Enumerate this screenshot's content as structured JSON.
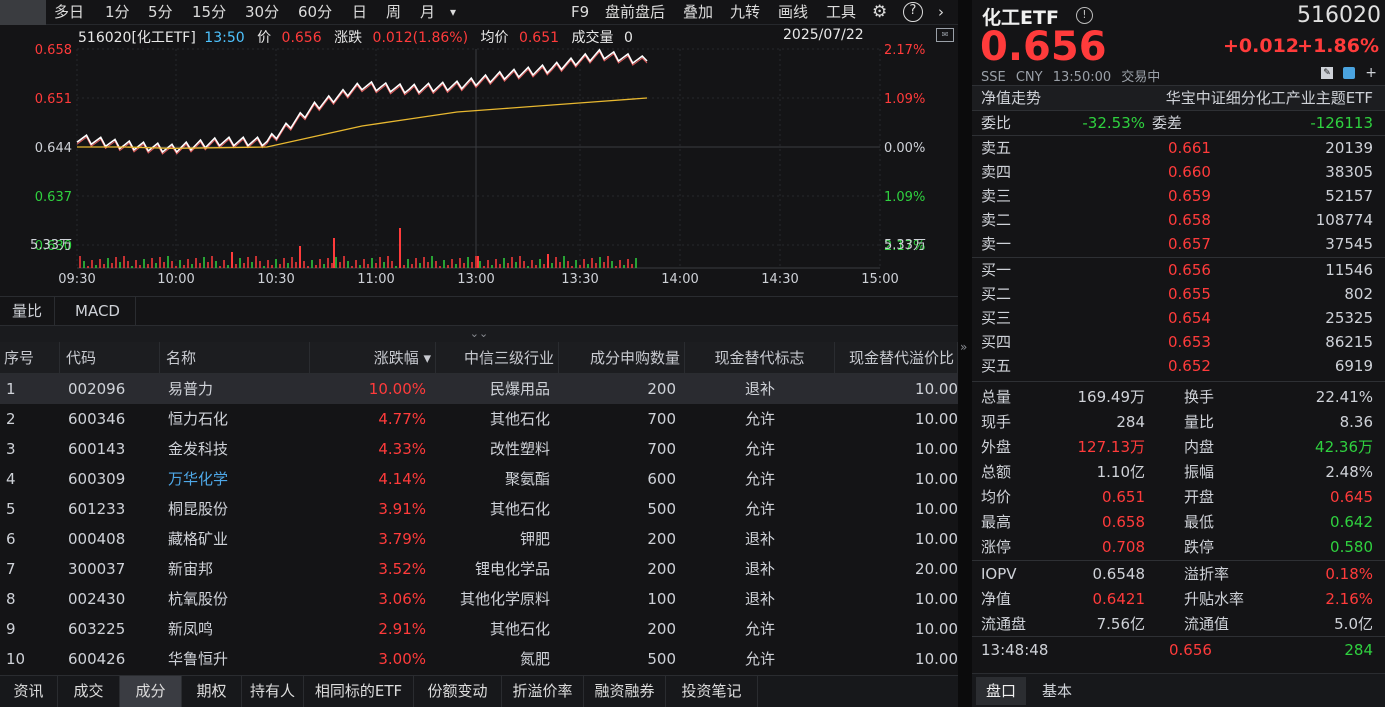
{
  "toolbar": {
    "items": [
      "多日",
      "1分",
      "5分",
      "15分",
      "30分",
      "60分",
      "日",
      "周",
      "月"
    ],
    "dropdown": "▾",
    "right_items": [
      "F9",
      "盘前盘后",
      "叠加",
      "九转",
      "画线",
      "工具"
    ]
  },
  "chart": {
    "header": {
      "code": "516020[化工ETF]",
      "time": "13:50",
      "price_label": "价",
      "price": "0.656",
      "change_label": "涨跌",
      "change": "0.012(1.86%)",
      "avg_label": "均价",
      "avg": "0.651",
      "vol_label": "成交量",
      "vol": "0",
      "date": "2025/07/22"
    },
    "y_left": [
      "0.658",
      "0.651",
      "0.644",
      "0.637",
      "0.630"
    ],
    "y_right": [
      "2.17%",
      "1.09%",
      "0.00%",
      "1.09%",
      "2.17%"
    ],
    "vol_max": "5.33万",
    "x_labels": [
      "09:30",
      "10:00",
      "10:30",
      "11:00",
      "13:00",
      "13:30",
      "14:00",
      "14:30",
      "15:00"
    ]
  },
  "chart_data": {
    "type": "line",
    "title": "516020[化工ETF]",
    "x": [
      "09:30",
      "09:45",
      "10:00",
      "10:15",
      "10:30",
      "10:45",
      "11:00",
      "11:15",
      "11:30/13:00",
      "13:15",
      "13:30",
      "13:45",
      "13:50"
    ],
    "series": [
      {
        "name": "价",
        "values": [
          0.645,
          0.644,
          0.6435,
          0.6445,
          0.6445,
          0.6495,
          0.6525,
          0.652,
          0.6525,
          0.654,
          0.655,
          0.657,
          0.656
        ]
      },
      {
        "name": "均价",
        "values": [
          0.644,
          0.644,
          0.6438,
          0.6439,
          0.644,
          0.6455,
          0.647,
          0.648,
          0.649,
          0.6495,
          0.65,
          0.6505,
          0.651
        ]
      }
    ],
    "ylim": [
      0.63,
      0.658
    ],
    "vol_max": "5.33万"
  },
  "indicator_tabs": [
    "量比",
    "MACD"
  ],
  "table": {
    "headers": [
      "序号",
      "代码",
      "名称",
      "涨跌幅 ▾",
      "中信三级行业",
      "成分申购数量",
      "现金替代标志",
      "现金替代溢价比"
    ],
    "rows": [
      [
        "1",
        "002096",
        "易普力",
        "10.00%",
        "民爆用品",
        "200",
        "退补",
        "10.00"
      ],
      [
        "2",
        "600346",
        "恒力石化",
        "4.77%",
        "其他石化",
        "700",
        "允许",
        "10.00"
      ],
      [
        "3",
        "600143",
        "金发科技",
        "4.33%",
        "改性塑料",
        "700",
        "允许",
        "10.00"
      ],
      [
        "4",
        "600309",
        "万华化学",
        "4.14%",
        "聚氨酯",
        "600",
        "允许",
        "10.00"
      ],
      [
        "5",
        "601233",
        "桐昆股份",
        "3.91%",
        "其他石化",
        "500",
        "允许",
        "10.00"
      ],
      [
        "6",
        "000408",
        "藏格矿业",
        "3.79%",
        "钾肥",
        "200",
        "退补",
        "10.00"
      ],
      [
        "7",
        "300037",
        "新宙邦",
        "3.52%",
        "锂电化学品",
        "200",
        "退补",
        "20.00"
      ],
      [
        "8",
        "002430",
        "杭氧股份",
        "3.06%",
        "其他化学原料",
        "100",
        "退补",
        "10.00"
      ],
      [
        "9",
        "603225",
        "新凤鸣",
        "2.91%",
        "其他石化",
        "200",
        "允许",
        "10.00"
      ],
      [
        "10",
        "600426",
        "华鲁恒升",
        "3.00%",
        "氮肥",
        "500",
        "允许",
        "10.00"
      ]
    ]
  },
  "bottom_tabs": [
    "资讯",
    "成交",
    "成分",
    "期权",
    "持有人",
    "相同标的ETF",
    "份额变动",
    "折溢价率",
    "融资融券",
    "投资笔记"
  ],
  "quote": {
    "name": "化工ETF",
    "code": "516020",
    "price": "0.656",
    "change": "+0.012",
    "pct": "+1.86%",
    "meta": [
      "SSE",
      "CNY",
      "13:50:00",
      "交易中"
    ],
    "nav_title": "净值走势",
    "fund_name": "华宝中证细分化工产业主题ETF",
    "weibi_label": "委比",
    "weibi": "-32.53%",
    "weicha_label": "委差",
    "weicha": "-126113",
    "asks": [
      [
        "卖五",
        "0.661",
        "20139"
      ],
      [
        "卖四",
        "0.660",
        "38305"
      ],
      [
        "卖三",
        "0.659",
        "52157"
      ],
      [
        "卖二",
        "0.658",
        "108774"
      ],
      [
        "卖一",
        "0.657",
        "37545"
      ]
    ],
    "bids": [
      [
        "买一",
        "0.656",
        "11546"
      ],
      [
        "买二",
        "0.655",
        "802"
      ],
      [
        "买三",
        "0.654",
        "25325"
      ],
      [
        "买四",
        "0.653",
        "86215"
      ],
      [
        "买五",
        "0.652",
        "6919"
      ]
    ],
    "stats": [
      [
        "总量",
        "169.49万",
        "换手",
        "22.41%"
      ],
      [
        "现手",
        "284",
        "量比",
        "8.36"
      ],
      [
        "外盘",
        "127.13万",
        "内盘",
        "42.36万"
      ],
      [
        "总额",
        "1.10亿",
        "振幅",
        "2.48%"
      ],
      [
        "均价",
        "0.651",
        "开盘",
        "0.645"
      ],
      [
        "最高",
        "0.658",
        "最低",
        "0.642"
      ],
      [
        "涨停",
        "0.708",
        "跌停",
        "0.580"
      ]
    ],
    "stats2": [
      [
        "IOPV",
        "0.6548",
        "溢折率",
        "0.18%"
      ],
      [
        "净值",
        "0.6421",
        "升贴水率",
        "2.16%"
      ],
      [
        "流通盘",
        "7.56亿",
        "流通值",
        "5.0亿"
      ]
    ],
    "tick": {
      "time": "13:48:48",
      "price": "0.656",
      "vol": "284"
    },
    "tabs": [
      "盘口",
      "基本"
    ]
  },
  "colors": {
    "up": "#ff3b3b",
    "down": "#2fd13f",
    "price_line": "#ffffff",
    "avg_line": "#e8b830",
    "bg": "#141416"
  }
}
